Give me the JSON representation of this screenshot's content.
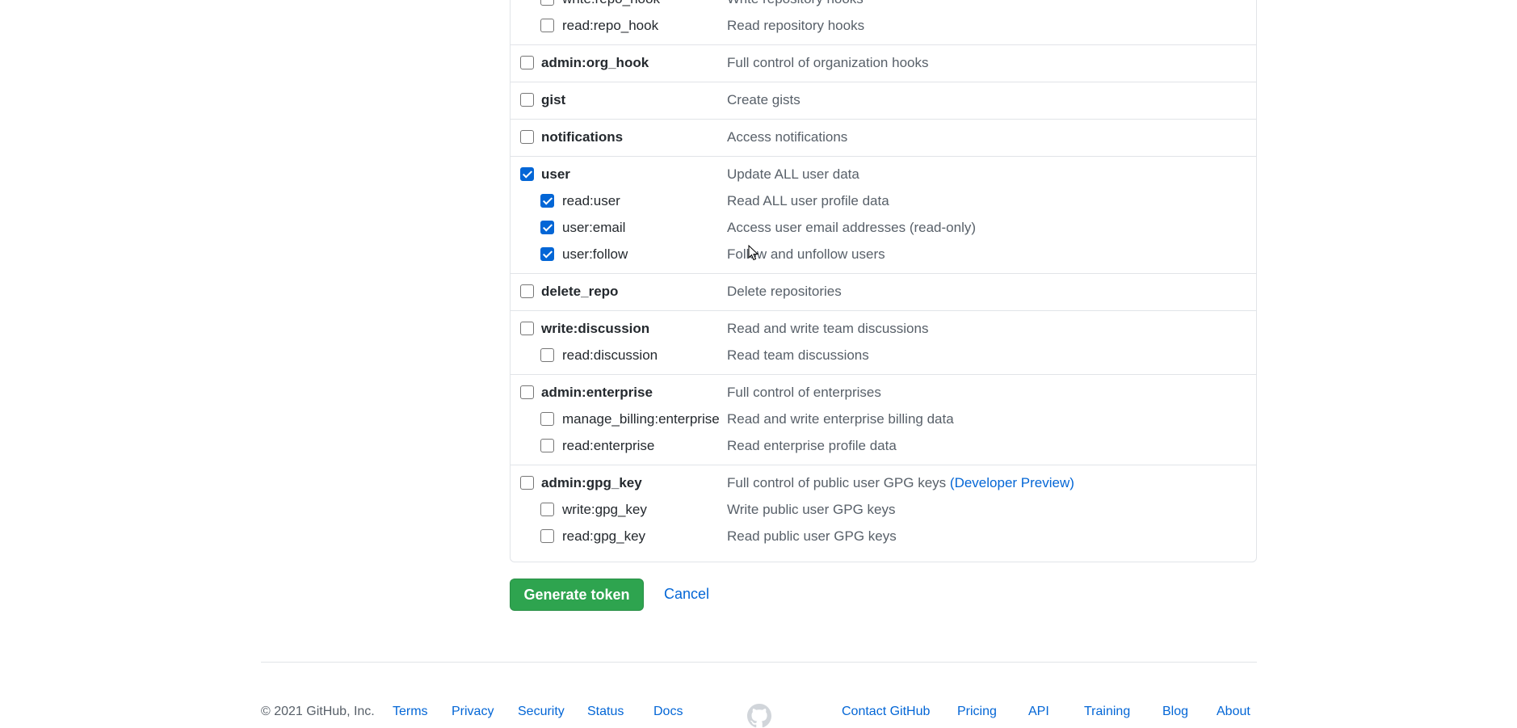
{
  "scopes": [
    {
      "name": "",
      "desc": "",
      "checked": false,
      "children": [
        {
          "name": "write:repo_hook",
          "desc": "Write repository hooks",
          "checked": false
        },
        {
          "name": "read:repo_hook",
          "desc": "Read repository hooks",
          "checked": false
        }
      ]
    },
    {
      "name": "admin:org_hook",
      "desc": "Full control of organization hooks",
      "checked": false,
      "children": []
    },
    {
      "name": "gist",
      "desc": "Create gists",
      "checked": false,
      "children": []
    },
    {
      "name": "notifications",
      "desc": "Access notifications",
      "checked": false,
      "children": []
    },
    {
      "name": "user",
      "desc": "Update ALL user data",
      "checked": true,
      "children": [
        {
          "name": "read:user",
          "desc": "Read ALL user profile data",
          "checked": true
        },
        {
          "name": "user:email",
          "desc": "Access user email addresses (read-only)",
          "checked": true
        },
        {
          "name": "user:follow",
          "desc": "Follow and unfollow users",
          "checked": true
        }
      ]
    },
    {
      "name": "delete_repo",
      "desc": "Delete repositories",
      "checked": false,
      "children": []
    },
    {
      "name": "write:discussion",
      "desc": "Read and write team discussions",
      "checked": false,
      "children": [
        {
          "name": "read:discussion",
          "desc": "Read team discussions",
          "checked": false
        }
      ]
    },
    {
      "name": "admin:enterprise",
      "desc": "Full control of enterprises",
      "checked": false,
      "children": [
        {
          "name": "manage_billing:enterprise",
          "desc": "Read and write enterprise billing data",
          "checked": false
        },
        {
          "name": "read:enterprise",
          "desc": "Read enterprise profile data",
          "checked": false
        }
      ]
    },
    {
      "name": "admin:gpg_key",
      "desc": "Full control of public user GPG keys",
      "desc_link": "(Developer Preview)",
      "checked": false,
      "children": [
        {
          "name": "write:gpg_key",
          "desc": "Write public user GPG keys",
          "checked": false
        },
        {
          "name": "read:gpg_key",
          "desc": "Read public user GPG keys",
          "checked": false
        }
      ]
    }
  ],
  "actions": {
    "generate_label": "Generate token",
    "cancel_label": "Cancel"
  },
  "footer": {
    "copyright": "© 2021 GitHub, Inc.",
    "left_links": [
      "Terms",
      "Privacy",
      "Security",
      "Status",
      "Docs"
    ],
    "right_links": [
      "Contact GitHub",
      "Pricing",
      "API",
      "Training",
      "Blog",
      "About"
    ],
    "logo_icon": "github-mark-icon"
  },
  "colors": {
    "accent": "#0366d6",
    "primary_button": "#2ea44f",
    "border": "#e1e4e8",
    "muted_text": "#586069"
  }
}
